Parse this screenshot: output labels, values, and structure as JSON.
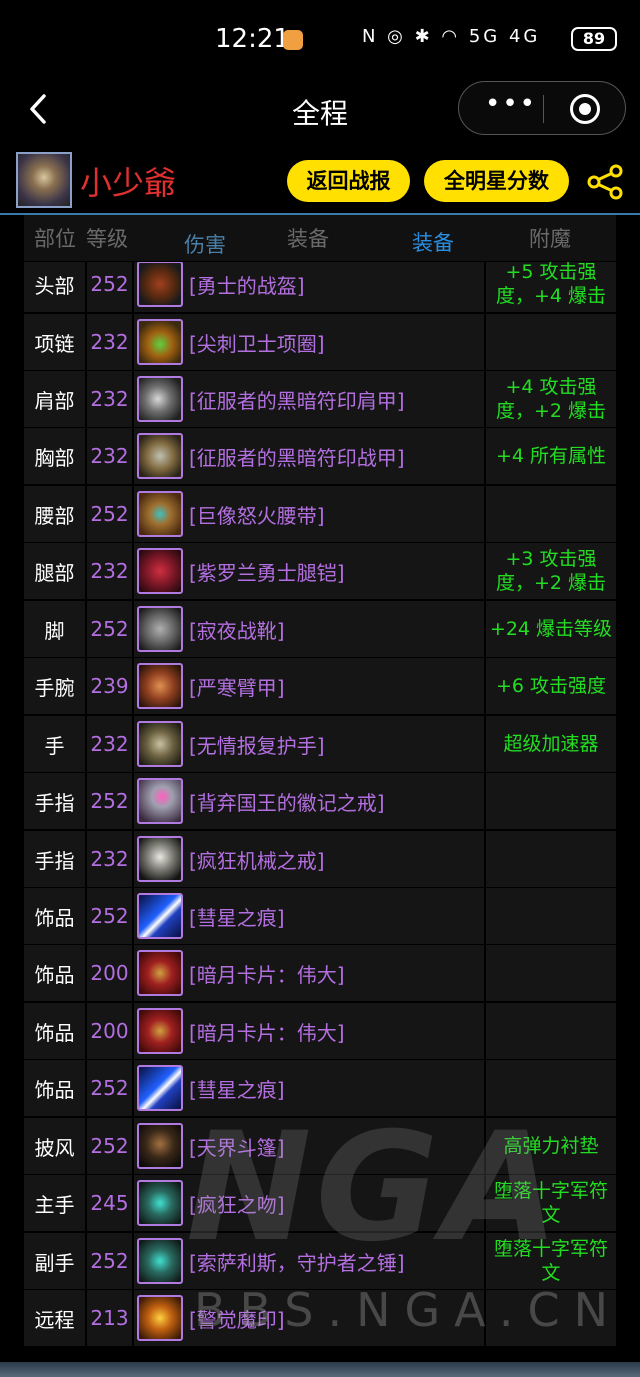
{
  "status_bar": {
    "time": "12:21",
    "network": "5G 4G",
    "battery": "89"
  },
  "nav": {
    "title": "全程",
    "more": "•••"
  },
  "profile": {
    "name": "小少爺",
    "back_btn": "返回战报",
    "allstar_btn": "全明星分数"
  },
  "table": {
    "headers": {
      "slot": "部位",
      "level": "等级",
      "damage": "伤害",
      "gear1": "装备",
      "gear2": "装备",
      "enchant": "附魔"
    },
    "rows": [
      {
        "slot": "头部",
        "level": "252",
        "item": "[勇士的战盔]",
        "enchant": "+5 攻击强度，+4 爆击",
        "icon": "helm-icon"
      },
      {
        "slot": "项链",
        "level": "232",
        "item": "[尖刺卫士项圈]",
        "enchant": "",
        "icon": "necklace-icon"
      },
      {
        "slot": "肩部",
        "level": "232",
        "item": "[征服者的黑暗符印肩甲]",
        "enchant": "+4 攻击强度，+2 爆击",
        "icon": "shoulder-icon"
      },
      {
        "slot": "胸部",
        "level": "232",
        "item": "[征服者的黑暗符印战甲]",
        "enchant": "+4 所有属性",
        "icon": "chest-icon"
      },
      {
        "slot": "腰部",
        "level": "252",
        "item": "[巨像怒火腰带]",
        "enchant": "",
        "icon": "belt-icon"
      },
      {
        "slot": "腿部",
        "level": "232",
        "item": "[紫罗兰勇士腿铠]",
        "enchant": "+3 攻击强度，+2 爆击",
        "icon": "legs-icon"
      },
      {
        "slot": "脚",
        "level": "252",
        "item": "[寂夜战靴]",
        "enchant": "+24 爆击等级",
        "icon": "boots-icon"
      },
      {
        "slot": "手腕",
        "level": "239",
        "item": "[严寒臂甲]",
        "enchant": "+6 攻击强度",
        "icon": "bracer-icon"
      },
      {
        "slot": "手",
        "level": "232",
        "item": "[无情报复护手]",
        "enchant": "超级加速器",
        "icon": "gloves-icon"
      },
      {
        "slot": "手指",
        "level": "252",
        "item": "[背弃国王的徽记之戒]",
        "enchant": "",
        "icon": "ring-icon"
      },
      {
        "slot": "手指",
        "level": "232",
        "item": "[疯狂机械之戒]",
        "enchant": "",
        "icon": "ring-icon"
      },
      {
        "slot": "饰品",
        "level": "252",
        "item": "[彗星之痕]",
        "enchant": "",
        "icon": "comet-trinket-icon"
      },
      {
        "slot": "饰品",
        "level": "200",
        "item": "[暗月卡片：伟大]",
        "enchant": "",
        "icon": "darkmoon-card-icon"
      },
      {
        "slot": "饰品",
        "level": "200",
        "item": "[暗月卡片：伟大]",
        "enchant": "",
        "icon": "darkmoon-card-icon"
      },
      {
        "slot": "饰品",
        "level": "252",
        "item": "[彗星之痕]",
        "enchant": "",
        "icon": "comet-trinket-icon"
      },
      {
        "slot": "披风",
        "level": "252",
        "item": "[天界斗篷]",
        "enchant": "高弹力衬垫",
        "icon": "cloak-icon"
      },
      {
        "slot": "主手",
        "level": "245",
        "item": "[疯狂之吻]",
        "enchant": "堕落十字军符文",
        "icon": "mainhand-icon"
      },
      {
        "slot": "副手",
        "level": "252",
        "item": "[索萨利斯，守护者之锤]",
        "enchant": "堕落十字军符文",
        "icon": "offhand-icon"
      },
      {
        "slot": "远程",
        "level": "213",
        "item": "[警觉魔印]",
        "enchant": "",
        "icon": "sigil-icon"
      }
    ]
  },
  "watermark": {
    "logo": "NGA",
    "url": "BBS.NGA.CN"
  },
  "colors": {
    "accent": "#ffe000",
    "item": "#b36ee0",
    "enchant": "#22dd22",
    "name": "#e03030"
  }
}
